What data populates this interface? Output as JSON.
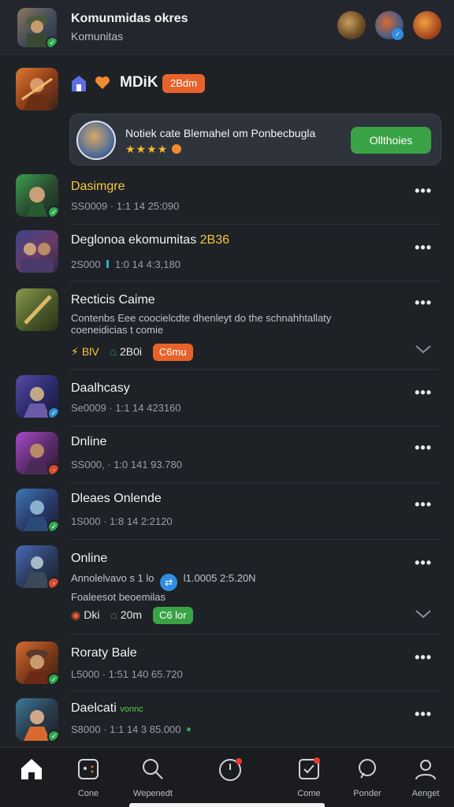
{
  "header": {
    "title": "Komunmidas okres",
    "subtitle": "Komunitas"
  },
  "featured": {
    "title": "MDiK",
    "tag": "2Bdm"
  },
  "card": {
    "title": "Notiek cate Blemahel om Ponbecbugla",
    "stars": "★★★★",
    "button": "Ollthoies"
  },
  "rows": [
    {
      "title": "Dasimgre",
      "meta": "SS0009 · 1:1 14 25:090"
    },
    {
      "title": "Deglonoa ekomumitas",
      "title_extra": "2B36",
      "meta": "2S000",
      "meta_extra": "1:0 14 4:3,180"
    },
    {
      "title": "Recticis Caime",
      "desc1": "Contenbs Eee coocielcdte dhenleyt do the schnahhtallaty",
      "desc2": "coeneidicias t comie",
      "stat1": "BlV",
      "stat2": "2B0i",
      "pill": "C6mu"
    },
    {
      "title": "Daalhcasy",
      "meta": "Se0009 · 1:1 14 423160"
    },
    {
      "title": "Dnline",
      "meta": "SS000,  · 1:0 141 93.780"
    },
    {
      "title": "Dleaes Onlende",
      "meta": "1S000  · 1:8 14 2:2120"
    },
    {
      "title": "Online",
      "desc1": "Annolelvavo s 1 lo",
      "desc1_extra": "l1.0005 2:5.20N",
      "desc2": "Foaleesot beoemilas",
      "stat1": "Dki",
      "stat2": "20m",
      "pill": "C6 lor"
    },
    {
      "title": "Roraty Bale",
      "meta": "L5000  · 1:51 140 65.720"
    },
    {
      "title": "Daelcati",
      "title_extra": "vonnc",
      "meta": "S8000  · 1:1 14 3 85.000"
    }
  ],
  "nav": {
    "home": "",
    "games": "Cone",
    "search": "Wepenedt",
    "create": "",
    "game": "Come",
    "profile": "Ponder",
    "account": "Aenget"
  },
  "colors": {
    "accent_orange": "#e8632a",
    "accent_green": "#3aa346",
    "background": "#1e2126"
  }
}
